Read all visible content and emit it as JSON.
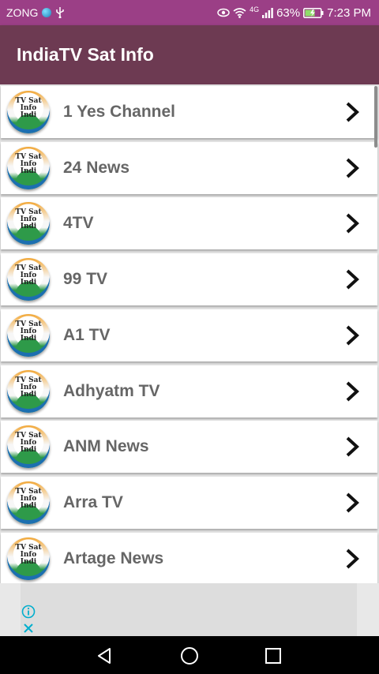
{
  "status_bar": {
    "carrier": "ZONG",
    "network": "4G",
    "battery": "63%",
    "time": "7:23 PM"
  },
  "app_bar": {
    "title": "IndiaTV Sat Info"
  },
  "channels": [
    {
      "name": "1 Yes Channel",
      "logo_text": [
        "TV Sat",
        "Info",
        "Indi"
      ]
    },
    {
      "name": "24 News",
      "logo_text": [
        "TV Sat",
        "Info",
        "Indi"
      ]
    },
    {
      "name": "4TV",
      "logo_text": [
        "TV Sat",
        "Info",
        "Indi"
      ]
    },
    {
      "name": "99 TV",
      "logo_text": [
        "TV Sat",
        "Info",
        "Indi"
      ]
    },
    {
      "name": "A1 TV",
      "logo_text": [
        "TV Sat",
        "Info",
        "Indi"
      ]
    },
    {
      "name": "Adhyatm TV",
      "logo_text": [
        "TV Sat",
        "Info",
        "Indi"
      ]
    },
    {
      "name": "ANM News",
      "logo_text": [
        "TV Sat",
        "Info",
        "Indi"
      ]
    },
    {
      "name": "Arra TV",
      "logo_text": [
        "TV Sat",
        "Info",
        "Indi"
      ]
    },
    {
      "name": "Artage News",
      "logo_text": [
        "TV Sat",
        "Info",
        "Indi"
      ]
    }
  ],
  "icons": {
    "row_action": "chevron-right-icon",
    "ad_info": "info-icon",
    "ad_close": "close-icon",
    "nav_back": "back-icon",
    "nav_home": "home-icon",
    "nav_recents": "recents-icon"
  },
  "colors": {
    "status_bar": "#9b3f86",
    "app_bar": "#6d3a52",
    "list_text": "#666666",
    "ad_accent": "#00aecd"
  }
}
